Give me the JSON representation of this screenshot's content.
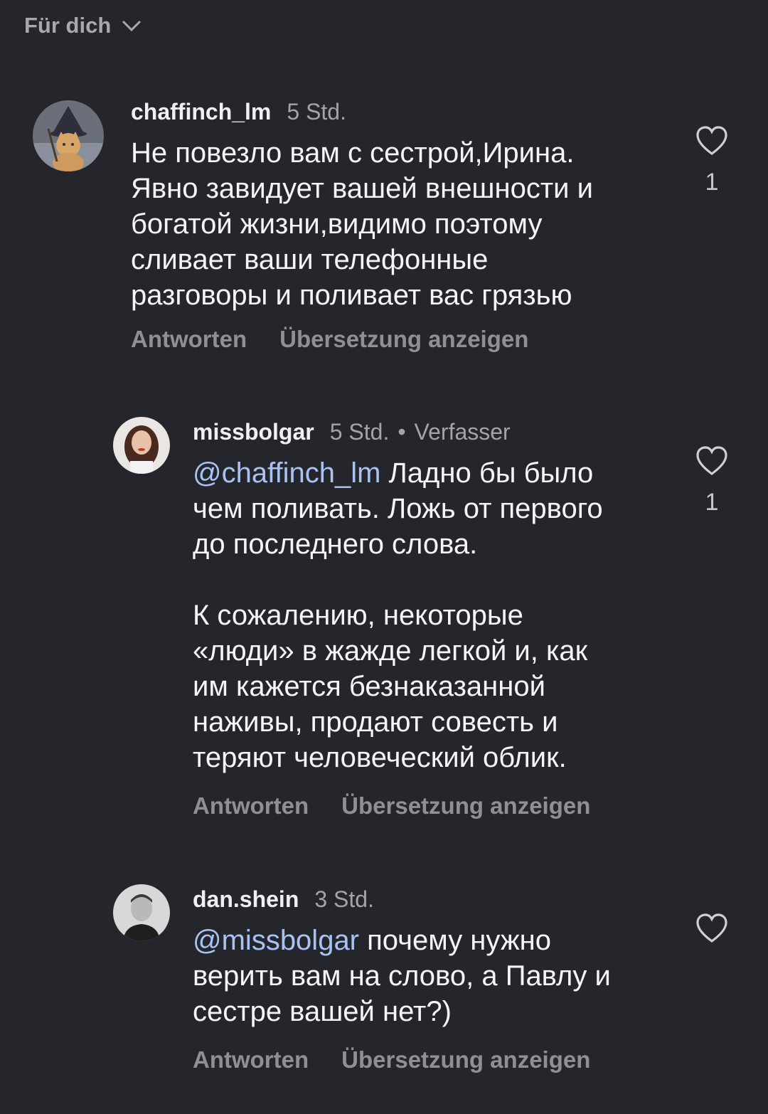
{
  "header": {
    "title": "Für dich",
    "icon": "chevron-down-icon"
  },
  "comments": [
    {
      "username": "chaffinch_lm",
      "time": "5 Std.",
      "text": "Не повезло вам с сестрой,Ирина.\nЯвно завидует вашей внешности и\nбогатой жизни,видимо поэтому\nсливает ваши телефонные\nразговоры и поливает вас грязью",
      "likes": "1",
      "reply_label": "Antworten",
      "translate_label": "Übersetzung anzeigen",
      "avatar": "wizard-cat-avatar"
    },
    {
      "username": "missbolgar",
      "time": "5 Std.",
      "dot": "•",
      "author_tag": "Verfasser",
      "mention": "@chaffinch_lm",
      "text": " Ладно бы было\nчем поливать. Ложь от первого\nдо последнего слова.\n\nК сожалению, некоторые\n«люди» в жажде легкой и, как\nим кажется безнаказанной\nнаживы, продают совесть и\nтеряют человеческий облик.",
      "likes": "1",
      "reply_label": "Antworten",
      "translate_label": "Übersetzung anzeigen",
      "avatar": "woman-portrait-avatar"
    },
    {
      "username": "dan.shein",
      "time": "3 Std.",
      "mention": "@missbolgar",
      "text": " почему нужно\nверить вам на слово, а Павлу и\nсестре вашей нет?)",
      "reply_label": "Antworten",
      "translate_label": "Übersetzung anzeigen",
      "avatar": "man-portrait-avatar"
    }
  ],
  "colors": {
    "background": "#25262b",
    "mention": "#a8c3f3",
    "secondary_text": "#a3a3a8"
  }
}
